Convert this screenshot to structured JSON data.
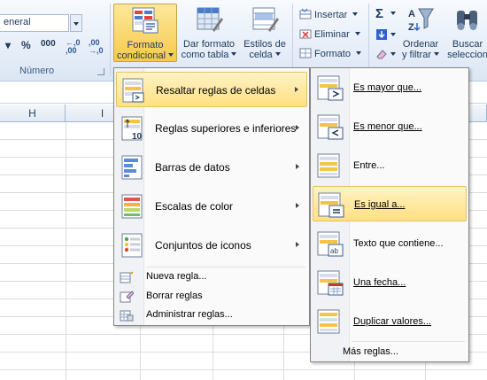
{
  "ribbon": {
    "number_format_value": "eneral",
    "percent_label": "%",
    "thousands_label": "000",
    "increase_decimals_label": "←,0 ,00",
    "decrease_decimals_label": ",00 →,0",
    "number_group_label": "Número",
    "conditional_format_line1": "Formato",
    "conditional_format_line2": "condicional",
    "format_table_line1": "Dar formato",
    "format_table_line2": "como tabla",
    "cell_styles_line1": "Estilos de",
    "cell_styles_line2": "celda",
    "insert_label": "Insertar",
    "delete_label": "Eliminar",
    "format_label": "Formato",
    "sort_filter_line1": "Ordenar",
    "sort_filter_line2": "y filtrar",
    "find_select_line1": "Buscar",
    "find_select_line2": "seleccion"
  },
  "columns": [
    "H",
    "I"
  ],
  "menu": {
    "items": [
      {
        "label": "Resaltar reglas de celdas",
        "icon": "highlight-cells-icon"
      },
      {
        "label": "Reglas superiores e inferiores",
        "icon": "top-bottom-icon"
      },
      {
        "label": "Barras de datos",
        "icon": "data-bars-icon"
      },
      {
        "label": "Escalas de color",
        "icon": "color-scales-icon"
      },
      {
        "label": "Conjuntos de iconos",
        "icon": "icon-sets-icon"
      }
    ],
    "small_items": [
      {
        "label": "Nueva regla..."
      },
      {
        "label": "Borrar reglas"
      },
      {
        "label": "Administrar reglas..."
      }
    ]
  },
  "submenu": {
    "items": [
      {
        "label": "Es mayor que..."
      },
      {
        "label": "Es menor que..."
      },
      {
        "label": "Entre..."
      },
      {
        "label": "Es igual a..."
      },
      {
        "label": "Texto que contiene..."
      },
      {
        "label": "Una fecha..."
      },
      {
        "label": "Duplicar valores..."
      }
    ],
    "more_rules": "Más reglas..."
  }
}
